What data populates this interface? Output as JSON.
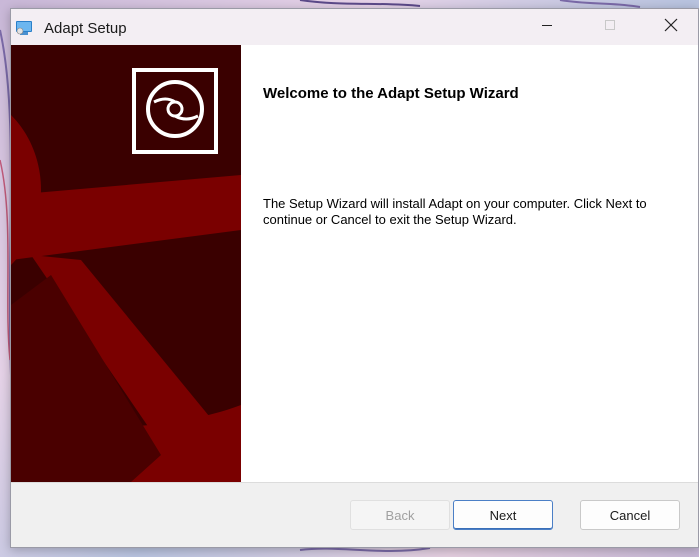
{
  "window": {
    "title": "Adapt Setup",
    "app_icon": "installer-icon",
    "controls": {
      "minimize": "minimize-icon",
      "maximize": "maximize-icon",
      "close": "close-icon"
    }
  },
  "side_panel": {
    "background_color": "#3a0000",
    "accent_color": "#7a0000",
    "logo_icon": "disc-icon"
  },
  "content": {
    "heading": "Welcome to the Adapt Setup Wizard",
    "description": "The Setup Wizard will install Adapt on your computer. Click Next to continue or Cancel to exit the Setup Wizard."
  },
  "buttons": {
    "back": "Back",
    "next": "Next",
    "cancel": "Cancel"
  }
}
